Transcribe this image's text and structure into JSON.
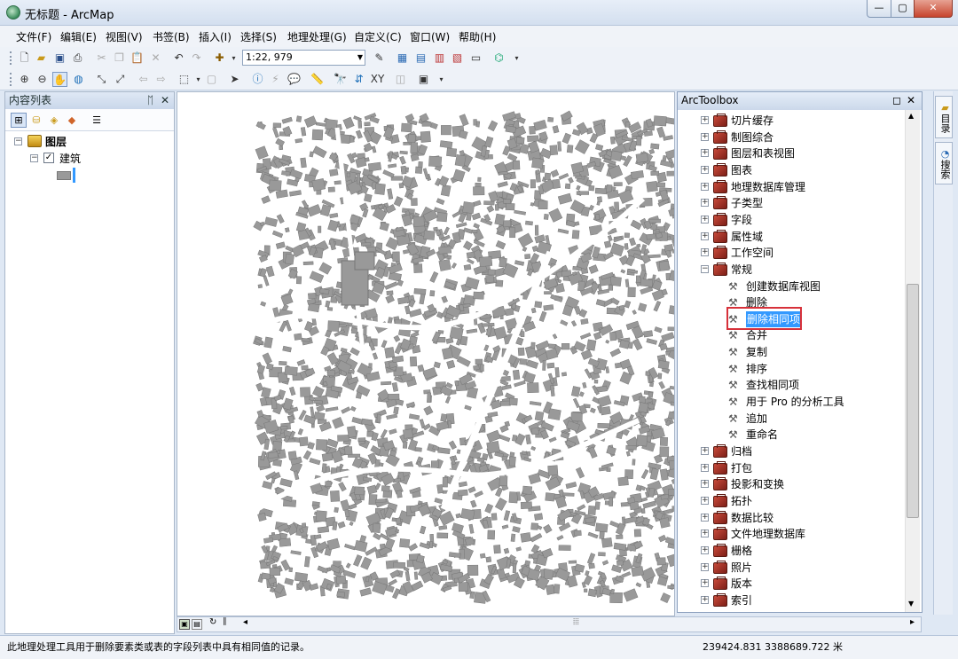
{
  "window": {
    "title": "无标题 - ArcMap",
    "minimize": "—",
    "maximize": "▢",
    "close": "✕"
  },
  "menu": [
    "文件(F)",
    "编辑(E)",
    "视图(V)",
    "书签(B)",
    "插入(I)",
    "选择(S)",
    "地理处理(G)",
    "自定义(C)",
    "窗口(W)",
    "帮助(H)"
  ],
  "toolbar": {
    "scale": "1:22, 979"
  },
  "toc": {
    "title": "内容列表",
    "pin": "ᛖ",
    "close": "✕",
    "layers_group": "图层",
    "layer": "建筑"
  },
  "arctoolbox": {
    "title": "ArcToolbox",
    "toolsets": [
      "切片缓存",
      "制图综合",
      "图层和表视图",
      "图表",
      "地理数据库管理",
      "子类型",
      "字段",
      "属性域",
      "工作空间",
      "常规"
    ],
    "general_tools": [
      "创建数据库视图",
      "删除",
      "删除相同项",
      "合并",
      "复制",
      "排序",
      "查找相同项",
      "用于 Pro 的分析工具",
      "追加",
      "重命名"
    ],
    "toolsets_after": [
      "归档",
      "打包",
      "投影和变换",
      "拓扑",
      "数据比较",
      "文件地理数据库",
      "栅格",
      "照片",
      "版本",
      "索引"
    ],
    "selected_tool": "删除相同项"
  },
  "side_tabs": [
    "目录",
    "搜索"
  ],
  "status": {
    "message": "此地理处理工具用于删除要素类或表的字段列表中具有相同值的记录。",
    "coords": "239424.831  3388689.722 米"
  },
  "colors": {
    "accent": "#3399ff",
    "highlight_box": "#d7313a",
    "building_fill": "#999999"
  }
}
